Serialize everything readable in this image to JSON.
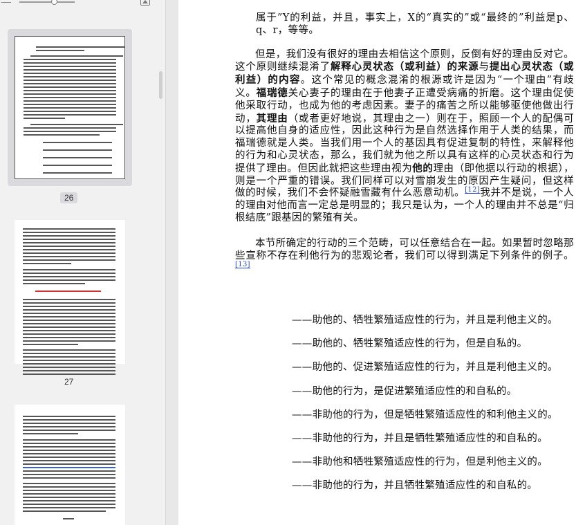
{
  "sidebar": {
    "thumbnails": [
      {
        "page_label": "26",
        "selected": true
      },
      {
        "page_label": "27",
        "selected": false
      },
      {
        "page_label": "",
        "selected": false
      }
    ]
  },
  "reader": {
    "p_intro": "属于”Y的利益，并且，事实上，X的“真实的”或“最终的”利益是p、q、r，等等。",
    "p2_a": "但是，我们没有很好的理由去相信这个原则，反倒有好的理由反对它。这个原则继续混淆了",
    "p2_b1": "解释心灵状态（或利益）的来源",
    "p2_c": "与",
    "p2_b2": "提出心灵状态（或利益）的内容",
    "p2_d": "。这个常见的概念混淆的根源或许是因为“一个理由”有歧义。",
    "p2_b3": "福瑞德",
    "p2_e": "关心妻子的理由在于他妻子正遭受病痛的折磨。这个理由促使他采取行动，也成为他的考虑因素。妻子的痛苦之所以能够驱使他做出行动，",
    "p2_b4": "其理由",
    "p2_f": "（或者更好地说，其理由之一）则在于，照顾一个人的配偶可以提高他自身的适应性，因此这种行为是自然选择作用于人类的结果，而福瑞德就是人类。当我们用一个人的基因具有促进复制的特性，来解释他的行为和心灵状态，那么，我们就为他之所以具有这样的心灵状态和行为提供了理由。但因此就把这些理由视为",
    "p2_b5": "他的",
    "p2_g": "理由（即他据以行动的根据），则是一个严重的错误。我们同样可以对雪崩发生的原因产生疑问，但这样做的时候，我们不会怀疑融雪藏有什么恶意动机。",
    "fn12": "[12]",
    "p2_h": "我并不是说，一个人的理由对他而言一定总是明显的；我只是认为，一个人的理由并不总是“归根结底”跟基因的繁殖有关。",
    "p3_a": "本节所确定的行动的三个范畴，可以任意结合在一起。如果暂时忽略那些宣称不存在利他行为的悲观论者，我们可以得到满足下列条件的例子。",
    "fn13": "[13]",
    "list": [
      "——助他的、牺牲繁殖适应性的行为，并且是利他主义的。",
      "——助他的、牺牲繁殖适应性的行为，但是自私的。",
      "——助他的、促进繁殖适应性的行为，并且是利他主义的。",
      "——助他的行为，是促进繁殖适应性的和自私的。",
      "——非助他的行为，但是牺牲繁殖适应性的和利他主义的。",
      "——非助他的行为，并且是牺牲繁殖适应性的和自私的。",
      "——非助他和牺牲繁殖适应性的行为，但是利他主义的。",
      "——非助他的行为，并且牺牲繁殖适应性的和自私的。"
    ]
  }
}
